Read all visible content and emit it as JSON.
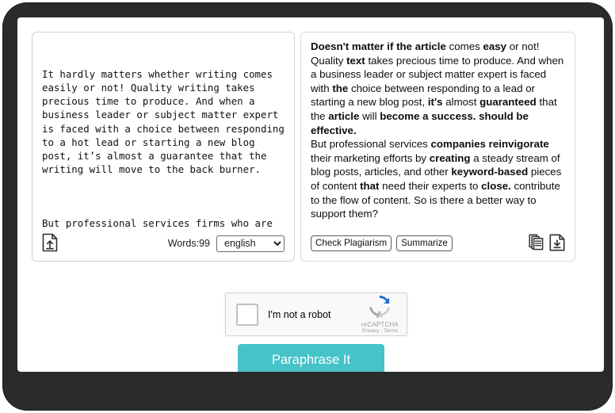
{
  "theme": {
    "bezel_color": "#2b2b2b",
    "screen_color": "#ffffff",
    "accent_color": "#45c3c8",
    "panel_border_color": "#d0d0d0",
    "captcha_bg_color": "#f9f9f9"
  },
  "left_panel": {
    "name": "source-text-panel",
    "paragraphs": [
      "It hardly matters whether writing comes easily or not! Quality writing takes precious time to produce. And when a business leader or subject matter expert is faced with a choice between responding to a hot lead or starting a new blog post, it’s almost a guarantee that the writing will move to the back burner.",
      "But professional services firms who are revitalizing their marketing efforts by producing a steady stream of keyword-driven blog posts, articles, and other pieces of content need their experts to contribute to the flow of content. So is there a better way to support them?"
    ],
    "toolbar": {
      "upload_icon": "upload-file-icon",
      "word_count_label": "Words:99",
      "language_value": "english",
      "language_options": [
        "english"
      ]
    }
  },
  "right_panel": {
    "name": "paraphrased-text-panel",
    "paragraphs": [
      [
        {
          "text": "Doesn't matter if the article",
          "bold": true
        },
        {
          "text": " comes ",
          "bold": false
        },
        {
          "text": "easy",
          "bold": true
        },
        {
          "text": " or not! Quality ",
          "bold": false
        },
        {
          "text": "text",
          "bold": true
        },
        {
          "text": " takes precious time to produce. And when a business leader or subject matter expert is faced with ",
          "bold": false
        },
        {
          "text": "the",
          "bold": true
        },
        {
          "text": " choice between responding to a lead or starting a new blog post, ",
          "bold": false
        },
        {
          "text": "it's",
          "bold": true
        },
        {
          "text": " almost ",
          "bold": false
        },
        {
          "text": "guaranteed",
          "bold": true
        },
        {
          "text": " that the ",
          "bold": false
        },
        {
          "text": "article",
          "bold": true
        },
        {
          "text": " will ",
          "bold": false
        },
        {
          "text": "become a success. should be effective.",
          "bold": true
        }
      ],
      [
        {
          "text": "But professional services ",
          "bold": false
        },
        {
          "text": "companies reinvigorate",
          "bold": true
        },
        {
          "text": " their marketing efforts by ",
          "bold": false
        },
        {
          "text": "creating",
          "bold": true
        },
        {
          "text": " a steady stream of blog posts, articles, and other ",
          "bold": false
        },
        {
          "text": "keyword-based",
          "bold": true
        },
        {
          "text": " pieces of content ",
          "bold": false
        },
        {
          "text": "that",
          "bold": true
        },
        {
          "text": " need their experts to ",
          "bold": false
        },
        {
          "text": "close.",
          "bold": true
        },
        {
          "text": " contribute to the flow of content. So is there a better way to support them?",
          "bold": false
        }
      ]
    ],
    "toolbar": {
      "check_plagiarism_label": "Check Plagiarism",
      "summarize_label": "Summarize",
      "copy_icon": "copy-icon",
      "download_icon": "download-file-icon"
    }
  },
  "captcha": {
    "name": "recaptcha-widget",
    "checkbox_label": "I'm not a robot",
    "brand_name": "reCAPTCHA",
    "legal_text": "Privacy - Terms",
    "logo_icon": "recaptcha-logo-icon"
  },
  "primary_action": {
    "label": "Paraphrase It"
  }
}
